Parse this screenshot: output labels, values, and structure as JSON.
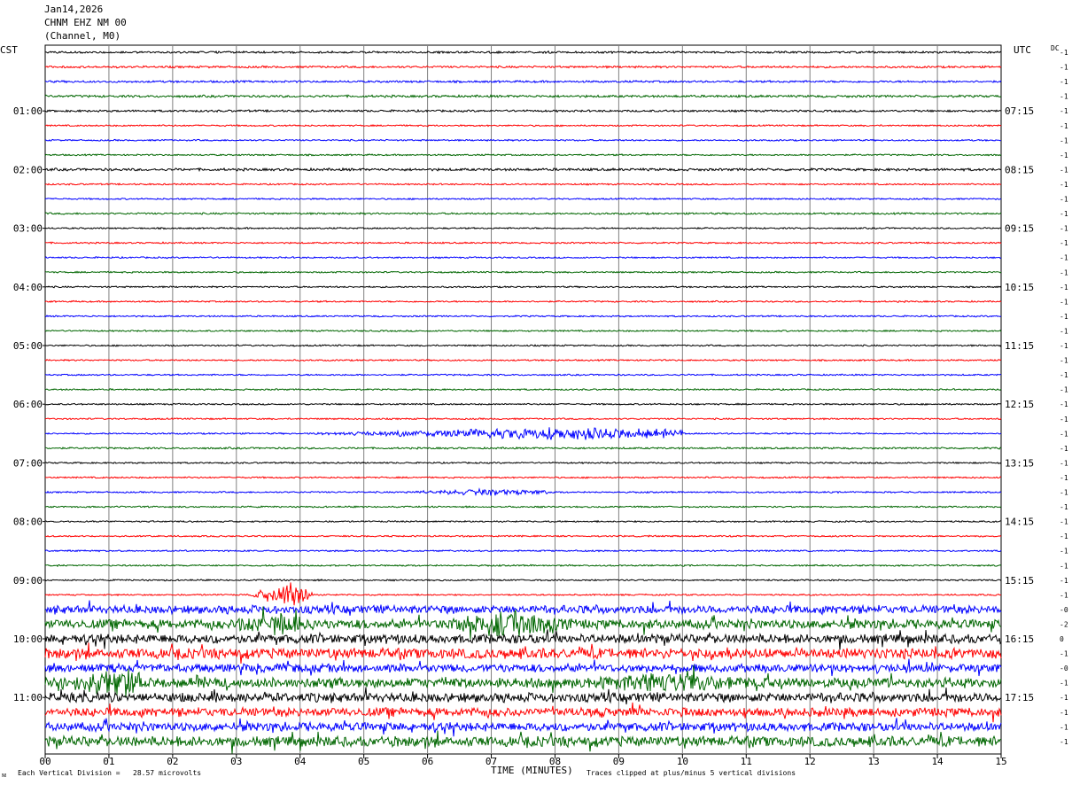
{
  "header": {
    "date": "Jan14,2026",
    "station": "CHNM EHZ NM 00",
    "subtitle": "(Channel, M0)"
  },
  "left_tz": "CST",
  "right_tz": "UTC",
  "dc_label": "DC",
  "footer": {
    "scale_note": "Each Vertical Division =   28.57 microvolts",
    "clip_note": "Traces clipped at plus/minus 5 vertical divisions"
  },
  "colors": {
    "trace_cycle": [
      "#000000",
      "#ff0000",
      "#0000ff",
      "#006600"
    ],
    "grid": "#808080"
  },
  "chart_data": {
    "type": "line",
    "title": "CHNM EHZ NM 00",
    "xlabel": "TIME (MINUTES)",
    "ylabel": "",
    "xlim": [
      0,
      15
    ],
    "x_ticks": [
      "00",
      "01",
      "02",
      "03",
      "04",
      "05",
      "06",
      "07",
      "08",
      "09",
      "10",
      "11",
      "12",
      "13",
      "14",
      "15"
    ],
    "left_hour_labels": [
      "01:00",
      "02:00",
      "03:00",
      "04:00",
      "05:00",
      "06:00",
      "07:00",
      "08:00",
      "09:00",
      "10:00",
      "11:00"
    ],
    "right_hour_labels": [
      "07:15",
      "08:15",
      "09:15",
      "10:15",
      "11:15",
      "12:15",
      "13:15",
      "14:15",
      "15:15",
      "16:15",
      "17:15"
    ],
    "trace_count": 48,
    "trace_minutes": 15,
    "dc_offsets": [
      "-1",
      "-1",
      "-1",
      "-1",
      "-1",
      "-1",
      "-1",
      "-1",
      "-1",
      "-1",
      "-1",
      "-1",
      "-1",
      "-1",
      "-1",
      "-1",
      "-1",
      "-1",
      "-1",
      "-1",
      "-1",
      "-1",
      "-1",
      "-1",
      "-1",
      "-1",
      "-1",
      "-1",
      "-1",
      "-1",
      "-1",
      "-1",
      "-1",
      "-1",
      "-1",
      "-1",
      "-1",
      "-1",
      "-0",
      "-2",
      "0",
      "-1",
      "-0",
      "-1",
      "-1",
      "-1",
      "-1",
      "-1"
    ],
    "trace_amplitude_divisions": [
      0.4,
      0.4,
      0.4,
      0.45,
      0.4,
      0.3,
      0.3,
      0.3,
      0.5,
      0.3,
      0.3,
      0.35,
      0.3,
      0.3,
      0.3,
      0.3,
      0.3,
      0.3,
      0.3,
      0.3,
      0.3,
      0.3,
      0.3,
      0.3,
      0.3,
      0.3,
      0.3,
      0.35,
      0.3,
      0.3,
      0.3,
      0.3,
      0.3,
      0.3,
      0.3,
      0.3,
      0.3,
      0.3,
      1.6,
      1.8,
      1.8,
      2.0,
      1.6,
      1.9,
      1.8,
      1.7,
      1.7,
      2.0
    ],
    "events": [
      {
        "trace": 26,
        "start_min": 4.0,
        "end_min": 10.0,
        "peak_min": 8.2,
        "peak_divisions": 1.6
      },
      {
        "trace": 30,
        "start_min": 5.5,
        "end_min": 7.9,
        "peak_min": 7.0,
        "peak_divisions": 0.8
      },
      {
        "trace": 37,
        "start_min": 3.2,
        "end_min": 4.2,
        "peak_min": 3.8,
        "peak_divisions": 4.0
      },
      {
        "trace": 39,
        "start_min": 3.0,
        "end_min": 4.3,
        "peak_min": 3.6,
        "peak_divisions": 2.5
      },
      {
        "trace": 39,
        "start_min": 6.2,
        "end_min": 8.3,
        "peak_min": 7.3,
        "peak_divisions": 3.0
      },
      {
        "trace": 43,
        "start_min": 0.0,
        "end_min": 1.5,
        "peak_min": 1.2,
        "peak_divisions": 2.5
      },
      {
        "trace": 43,
        "start_min": 8.2,
        "end_min": 11.0,
        "peak_min": 9.8,
        "peak_divisions": 2.0
      }
    ]
  }
}
